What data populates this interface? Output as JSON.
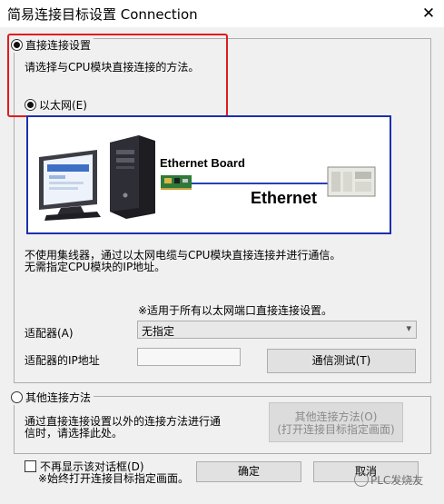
{
  "window": {
    "title": "简易连接目标设置 Connection",
    "close_glyph": "✕"
  },
  "direct": {
    "label": "直接连接设置",
    "description": "请选择与CPU模块直接连接的方法。",
    "ethernet_option": "以太网(E)"
  },
  "diagram": {
    "board_label": "Ethernet Board",
    "network_label": "Ethernet"
  },
  "info": {
    "line1": "不使用集线器，通过以太网电缆与CPU模块直接连接并进行通信。",
    "line2": "无需指定CPU模块的IP地址。",
    "note": "※适用于所有以太网端口直接连接设置。"
  },
  "adapter": {
    "label": "适配器(A)",
    "selected": "无指定",
    "ip_label": "适配器的IP地址",
    "ip_value": "",
    "test_button": "通信测试(T)"
  },
  "other": {
    "label": "其他连接方法",
    "desc1": "通过直接连接设置以外的连接方法进行通",
    "desc2": "信时，请选择此处。",
    "button_line1": "其他连接方法(O)",
    "button_line2": "(打开连接目标指定画面)"
  },
  "footer": {
    "checkbox_label": "不再显示该对话框(D)",
    "checkbox_note": "※始终打开连接目标指定画面。",
    "ok": "确定",
    "cancel": "取消"
  },
  "watermark": {
    "text": "PLC发烧友"
  },
  "colors": {
    "highlight_border": "#e01c1c",
    "diagram_border": "#1c2fb0"
  }
}
